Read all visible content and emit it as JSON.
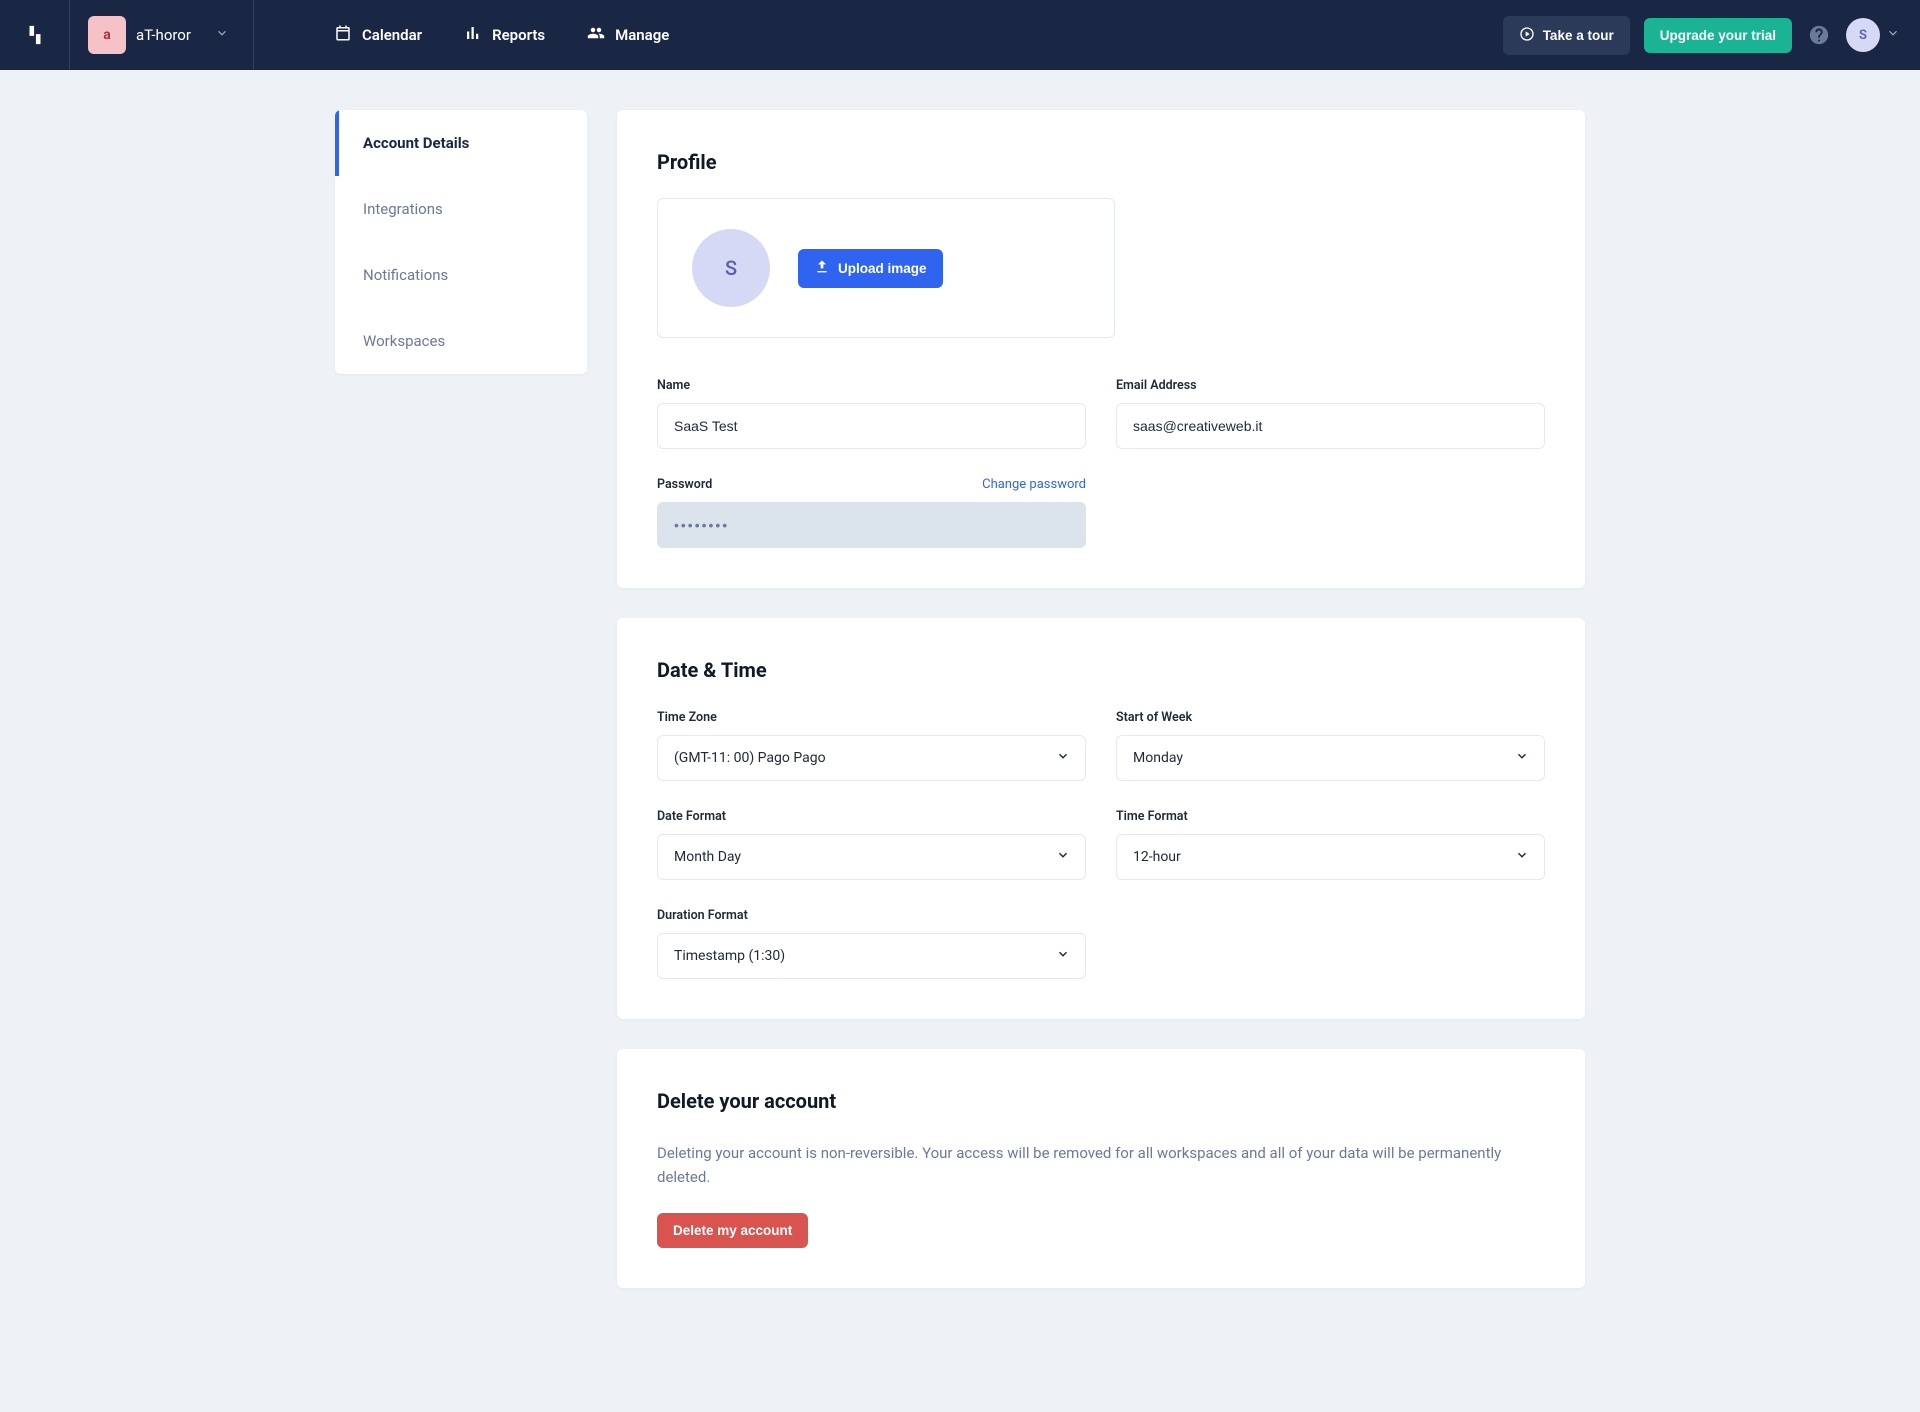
{
  "header": {
    "workspace_initial": "a",
    "workspace_name": "aT-horor",
    "nav": {
      "calendar": "Calendar",
      "reports": "Reports",
      "manage": "Manage"
    },
    "tour_label": "Take a tour",
    "upgrade_label": "Upgrade your trial",
    "user_initial": "S"
  },
  "sidebar": {
    "items": [
      {
        "label": "Account Details"
      },
      {
        "label": "Integrations"
      },
      {
        "label": "Notifications"
      },
      {
        "label": "Workspaces"
      }
    ]
  },
  "profile": {
    "heading": "Profile",
    "avatar_initial": "S",
    "upload_label": "Upload image",
    "name_label": "Name",
    "name_value": "SaaS Test",
    "email_label": "Email Address",
    "email_value": "saas@creativeweb.it",
    "password_label": "Password",
    "change_password_link": "Change password",
    "password_mask": "••••••••"
  },
  "datetime": {
    "heading": "Date & Time",
    "tz_label": "Time Zone",
    "tz_value": "(GMT-11: 00) Pago Pago",
    "weekstart_label": "Start of Week",
    "weekstart_value": "Monday",
    "datefmt_label": "Date Format",
    "datefmt_value": "Month Day",
    "timefmt_label": "Time Format",
    "timefmt_value": "12-hour",
    "durfmt_label": "Duration Format",
    "durfmt_value": "Timestamp (1:30)"
  },
  "delete": {
    "heading": "Delete your account",
    "desc": "Deleting your account is non-reversible. Your access will be removed for all workspaces and all of your data will be permanently deleted.",
    "button": "Delete my account"
  }
}
